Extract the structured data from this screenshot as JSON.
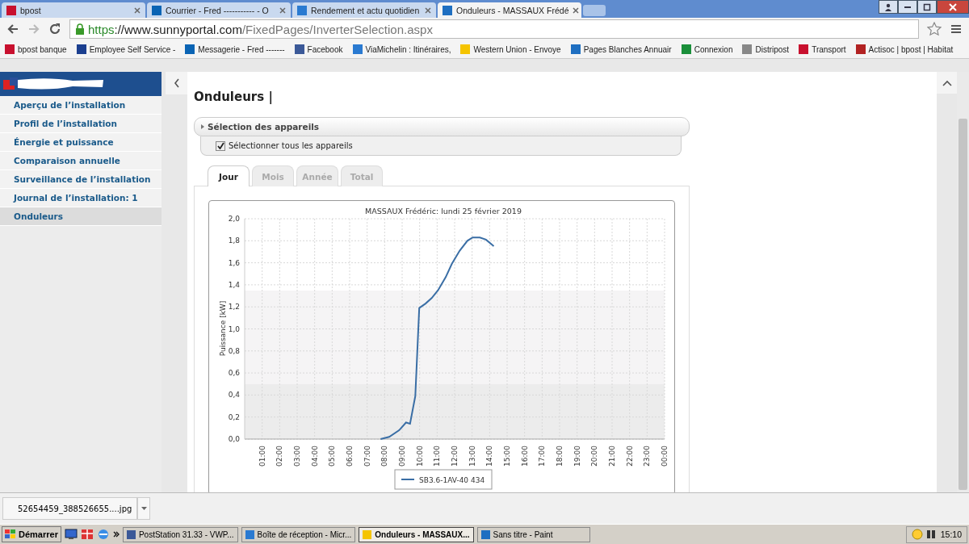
{
  "browser": {
    "tabs": [
      {
        "title": "bpost",
        "selected": false
      },
      {
        "title": "Courrier - Fred ----------- - O",
        "selected": false
      },
      {
        "title": "Rendement et actu quotidien",
        "selected": false
      },
      {
        "title": "Onduleurs - MASSAUX Frédé",
        "selected": true
      }
    ],
    "url": {
      "scheme": "https",
      "host": "://www.sunnyportal.com",
      "path": "/FixedPages/InverterSelection.aspx"
    },
    "bookmarks": [
      "bpost banque",
      "Employee Self Service -",
      "Messagerie - Fred -------",
      "Facebook",
      "ViaMichelin : Itinéraires,",
      "Western Union - Envoye",
      "Pages Blanches Annuair",
      "Connexion",
      "Distripost",
      "Transport",
      "Actisoc | bpost | Habitat"
    ]
  },
  "sidebar": {
    "items": [
      {
        "label": "Aperçu de l’installation",
        "selected": false
      },
      {
        "label": "Profil de l’installation",
        "selected": false
      },
      {
        "label": "Énergie et puissance",
        "selected": false
      },
      {
        "label": "Comparaison annuelle",
        "selected": false
      },
      {
        "label": "Surveillance de l’installation",
        "selected": false
      },
      {
        "label": "Journal de l’installation: 1",
        "selected": false
      },
      {
        "label": "Onduleurs",
        "selected": true
      }
    ]
  },
  "page": {
    "heading": "Onduleurs |",
    "device_selection": {
      "title": "Sélection des appareils",
      "select_all": {
        "label": "Sélectionner tous les appareils",
        "checked": true
      }
    },
    "tabs": [
      {
        "label": "Jour",
        "selected": true
      },
      {
        "label": "Mois",
        "selected": false
      },
      {
        "label": "Année",
        "selected": false
      },
      {
        "label": "Total",
        "selected": false
      }
    ],
    "chart_data": {
      "type": "line",
      "title": "MASSAUX Frédéric: lundi 25 février 2019",
      "ylabel": "Puissance [kW]",
      "x": [
        7.77,
        8.26,
        8.83,
        9.22,
        9.45,
        9.75,
        9.98,
        10.34,
        10.69,
        11.05,
        11.49,
        11.84,
        12.29,
        12.73,
        13.03,
        13.44,
        13.79,
        14.24
      ],
      "series": [
        {
          "name": "SB3.6-1AV-40 434",
          "color": "#3a6ea5",
          "values": [
            0.0,
            0.02,
            0.08,
            0.15,
            0.14,
            0.39,
            1.19,
            1.23,
            1.28,
            1.35,
            1.47,
            1.59,
            1.71,
            1.8,
            1.83,
            1.83,
            1.81,
            1.75
          ]
        }
      ],
      "xlim": [
        0,
        24
      ],
      "ylim": [
        0,
        2
      ],
      "grid": true,
      "xticks": [
        {
          "value": 1,
          "label": "01:00"
        },
        {
          "value": 2,
          "label": "02:00"
        },
        {
          "value": 3,
          "label": "03:00"
        },
        {
          "value": 4,
          "label": "04:00"
        },
        {
          "value": 5,
          "label": "05:00"
        },
        {
          "value": 6,
          "label": "06:00"
        },
        {
          "value": 7,
          "label": "07:00"
        },
        {
          "value": 8,
          "label": "08:00"
        },
        {
          "value": 9,
          "label": "09:00"
        },
        {
          "value": 10,
          "label": "10:00"
        },
        {
          "value": 11,
          "label": "11:00"
        },
        {
          "value": 12,
          "label": "12:00"
        },
        {
          "value": 13,
          "label": "13:00"
        },
        {
          "value": 14,
          "label": "14:00"
        },
        {
          "value": 15,
          "label": "15:00"
        },
        {
          "value": 16,
          "label": "16:00"
        },
        {
          "value": 17,
          "label": "17:00"
        },
        {
          "value": 18,
          "label": "18:00"
        },
        {
          "value": 19,
          "label": "19:00"
        },
        {
          "value": 20,
          "label": "20:00"
        },
        {
          "value": 21,
          "label": "21:00"
        },
        {
          "value": 22,
          "label": "22:00"
        },
        {
          "value": 23,
          "label": "23:00"
        },
        {
          "value": 24,
          "label": "00:00"
        }
      ],
      "yticks": [
        {
          "value": 0,
          "label": "0,0"
        },
        {
          "value": 0.2,
          "label": "0,2"
        },
        {
          "value": 0.4,
          "label": "0,4"
        },
        {
          "value": 0.6,
          "label": "0,6"
        },
        {
          "value": 0.8,
          "label": "0,8"
        },
        {
          "value": 1,
          "label": "1,0"
        },
        {
          "value": 1.2,
          "label": "1,2"
        },
        {
          "value": 1.4,
          "label": "1,4"
        },
        {
          "value": 1.6,
          "label": "1,6"
        },
        {
          "value": 1.8,
          "label": "1,8"
        },
        {
          "value": 2,
          "label": "2,0"
        }
      ]
    }
  },
  "download_bar": {
    "file": "52654459_388526655....jpg"
  },
  "taskbar": {
    "start": "Démarrer",
    "tasks": [
      {
        "label": "PostStation 31.33 - VWP...",
        "selected": false
      },
      {
        "label": "Boîte de réception - Micr...",
        "selected": false
      },
      {
        "label": "Onduleurs - MASSAUX...",
        "selected": true
      },
      {
        "label": "Sans titre - Paint",
        "selected": false
      }
    ],
    "clock": "15:10"
  }
}
